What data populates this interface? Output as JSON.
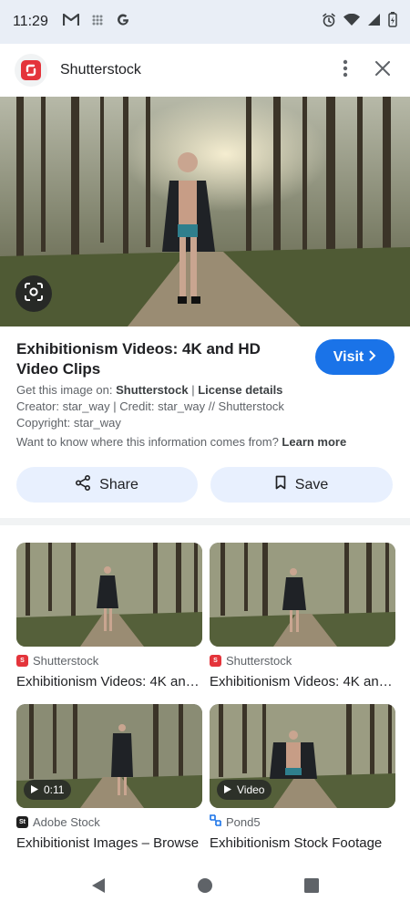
{
  "status_bar": {
    "time": "11:29"
  },
  "app_bar": {
    "title": "Shutterstock"
  },
  "result": {
    "title": "Exhibitionism Videos: 4K and HD Video Clips",
    "visit_label": "Visit",
    "source_prefix": "Get this image on:",
    "source_name": "Shutterstock",
    "license_label": "License details",
    "creator_line": "Creator: star_way | Credit: star_way // Shutterstock",
    "copyright_line": "Copyright: star_way",
    "info_question": "Want to know where this information comes from?",
    "learn_more": "Learn more",
    "share_label": "Share",
    "save_label": "Save"
  },
  "related": [
    {
      "source": "Shutterstock",
      "title": "Exhibitionism Videos: 4K and HD Video Clips",
      "badge": "",
      "logo_color": "#e4343b"
    },
    {
      "source": "Shutterstock",
      "title": "Exhibitionism Videos: 4K and HD Video Clips",
      "badge": "",
      "logo_color": "#e4343b"
    },
    {
      "source": "Adobe Stock",
      "title": "Exhibitionist Images – Browse",
      "badge": "0:11",
      "logo_color": "#1f1f1f"
    },
    {
      "source": "Pond5",
      "title": "Exhibitionism Stock Footage",
      "badge": "Video",
      "logo_color": "#1a73e8"
    }
  ],
  "colors": {
    "accent": "#1a73e8",
    "pill_bg": "#e8f0fe",
    "status_bg": "#e9eef6"
  },
  "icons": [
    "gmail-icon",
    "grid-icon",
    "google-icon",
    "alarm-icon",
    "wifi-icon",
    "signal-icon",
    "battery-icon",
    "more-vert-icon",
    "close-icon",
    "lens-icon",
    "chevron-right-icon",
    "share-icon",
    "bookmark-icon",
    "play-icon",
    "back-icon",
    "home-icon",
    "recents-icon"
  ]
}
